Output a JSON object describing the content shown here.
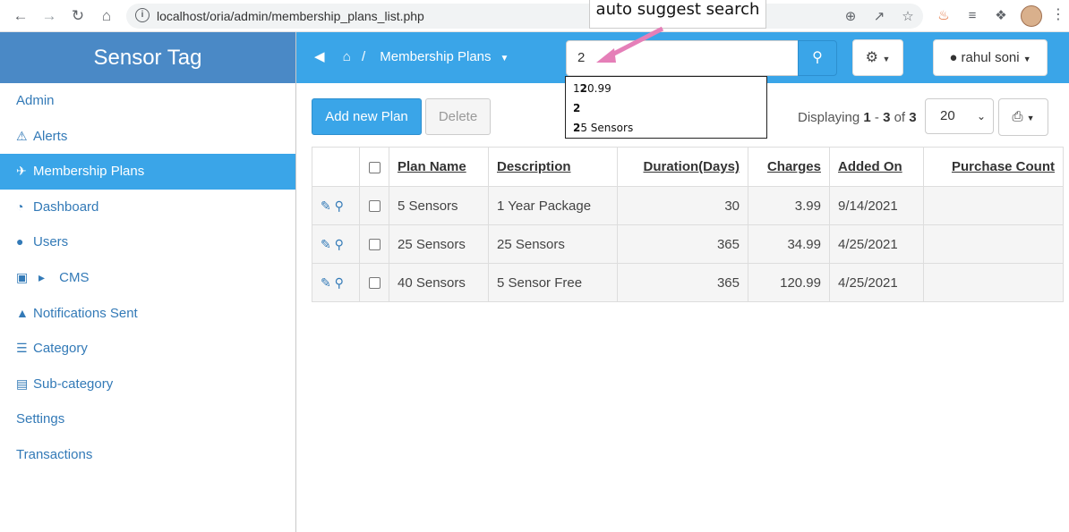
{
  "browser": {
    "url": "localhost/oria/admin/membership_plans_list.php"
  },
  "callout": {
    "text": "auto suggest search"
  },
  "sidebar": {
    "brand": "Sensor Tag",
    "items": [
      {
        "label": "Admin",
        "icon": ""
      },
      {
        "label": "Alerts",
        "icon": "warning-icon"
      },
      {
        "label": "Membership Plans",
        "icon": "plane-icon"
      },
      {
        "label": "Dashboard",
        "icon": "dashboard-icon"
      },
      {
        "label": "Users",
        "icon": "user-icon"
      },
      {
        "label": "CMS",
        "icon": "folder-icon"
      },
      {
        "label": "Notifications Sent",
        "icon": "bell-icon"
      },
      {
        "label": "Category",
        "icon": "list-icon"
      },
      {
        "label": "Sub-category",
        "icon": "list-alt-icon"
      },
      {
        "label": "Settings",
        "icon": ""
      },
      {
        "label": "Transactions",
        "icon": ""
      }
    ]
  },
  "header": {
    "breadcrumb_sep": "/",
    "breadcrumb_current": "Membership Plans",
    "search_value": "2",
    "user_name": "rahul soni"
  },
  "suggestions": [
    {
      "match": "1",
      "bold": "2",
      "rest": "0.99"
    },
    {
      "match": "",
      "bold": "2",
      "rest": ""
    },
    {
      "match": "",
      "bold": "2",
      "rest": "5 Sensors"
    }
  ],
  "toolbar": {
    "add_label": "Add new Plan",
    "delete_label": "Delete",
    "display_prefix": "Displaying",
    "range_start": "1",
    "range_sep": "-",
    "range_end": "3",
    "of": "of",
    "total": "3",
    "page_size": "20"
  },
  "table": {
    "headers": [
      "Plan Name",
      "Description",
      "Duration(Days)",
      "Charges",
      "Added On",
      "Purchase Count"
    ],
    "rows": [
      {
        "plan": "5 Sensors",
        "desc": "1 Year Package",
        "duration": "30",
        "charges": "3.99",
        "added": "9/14/2021",
        "count": ""
      },
      {
        "plan": "25 Sensors",
        "desc": "25 Sensors",
        "duration": "365",
        "charges": "34.99",
        "added": "4/25/2021",
        "count": ""
      },
      {
        "plan": "40 Sensors",
        "desc": "5 Sensor Free",
        "duration": "365",
        "charges": "120.99",
        "added": "4/25/2021",
        "count": ""
      }
    ]
  },
  "colors": {
    "accent": "#3aa5e8",
    "brand": "#4a89c6",
    "link": "#337ab7"
  }
}
